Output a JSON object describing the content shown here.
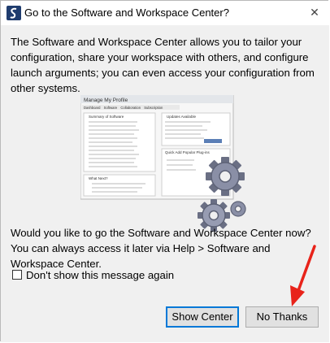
{
  "window": {
    "title": "Go to the Software and Workspace Center?",
    "close_glyph": "✕"
  },
  "intro_text": "The Software and Workspace Center allows you to tailor your configuration, share your workspace with others, and configure launch arguments; you can even access your configuration from other systems.",
  "illustration": {
    "header": "Manage My Profile",
    "tabs": [
      "Dashboard",
      "Software",
      "Collaboration",
      "Subscription"
    ],
    "left_title": "Summary of Software",
    "right_title": "Updates Available",
    "quick_title": "Quick Add Popular Plug-ins",
    "what_next": "What Next?",
    "icon": "gears-icon"
  },
  "question_text": "Would you like to go the Software and Workspace Center now? You can always access it later via Help > Software and Workspace Center.",
  "checkbox": {
    "label": "Don't show this message again",
    "checked": false
  },
  "buttons": {
    "show": "Show Center",
    "no": "No Thanks"
  },
  "colors": {
    "accent": "#0078d7",
    "annotation_arrow": "#e8231a"
  }
}
